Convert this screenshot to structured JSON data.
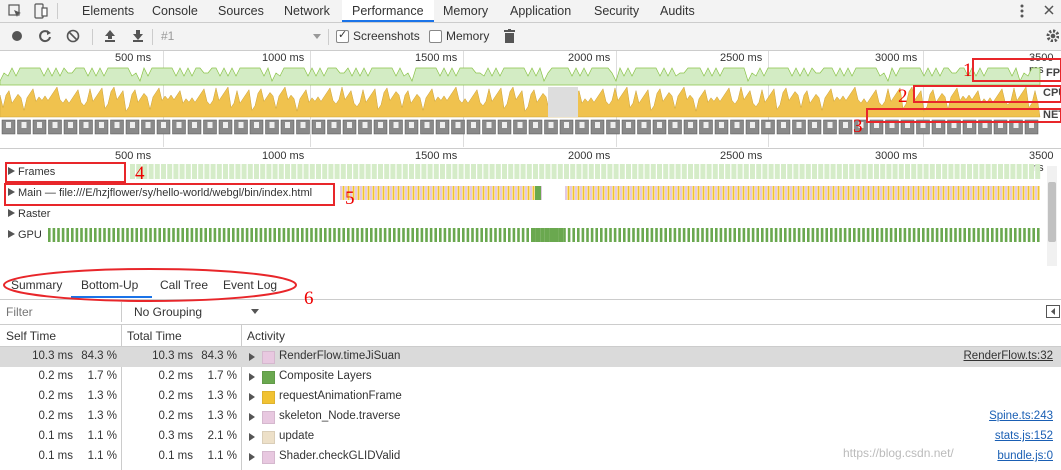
{
  "tabs": [
    "Elements",
    "Console",
    "Sources",
    "Network",
    "Performance",
    "Memory",
    "Application",
    "Security",
    "Audits"
  ],
  "active_tab": "Performance",
  "toolbar": {
    "profile_select": "#1",
    "screenshots_label": "Screenshots",
    "memory_label": "Memory"
  },
  "overview": {
    "ticks": [
      "500 ms",
      "1000 ms",
      "1500 ms",
      "2000 ms",
      "2500 ms",
      "3000 ms",
      "3500 ms"
    ],
    "track_labels": [
      "FPS",
      "CPU",
      "NET"
    ]
  },
  "timeline": {
    "ticks": [
      "500 ms",
      "1000 ms",
      "1500 ms",
      "2000 ms",
      "2500 ms",
      "3000 ms",
      "3500 ms"
    ],
    "frames_label": "Frames",
    "main_label": "Main — file:///E/hzjflower/sy/hello-world/webgl/bin/index.html",
    "raster_label": "Raster",
    "gpu_label": "GPU"
  },
  "bottom_tabs": [
    "Summary",
    "Bottom-Up",
    "Call Tree",
    "Event Log"
  ],
  "active_bottom_tab": "Bottom-Up",
  "filter": {
    "placeholder": "Filter",
    "grouping": "No Grouping"
  },
  "table": {
    "headers": {
      "self": "Self Time",
      "total": "Total Time",
      "activity": "Activity"
    },
    "rows": [
      {
        "self_ms": "10.3 ms",
        "self_pct": "84.3 %",
        "total_ms": "10.3 ms",
        "total_pct": "84.3 %",
        "activity": "RenderFlow.timeJiSuan",
        "color": "#e8c8e0",
        "source": "RenderFlow.ts:32"
      },
      {
        "self_ms": "0.2 ms",
        "self_pct": "1.7 %",
        "total_ms": "0.2 ms",
        "total_pct": "1.7 %",
        "activity": "Composite Layers",
        "color": "#6aa84f",
        "source": ""
      },
      {
        "self_ms": "0.2 ms",
        "self_pct": "1.3 %",
        "total_ms": "0.2 ms",
        "total_pct": "1.3 %",
        "activity": "requestAnimationFrame",
        "color": "#f1c232",
        "source": ""
      },
      {
        "self_ms": "0.2 ms",
        "self_pct": "1.3 %",
        "total_ms": "0.2 ms",
        "total_pct": "1.3 %",
        "activity": "skeleton_Node.traverse",
        "color": "#e8c8e0",
        "source": "Spine.ts:243"
      },
      {
        "self_ms": "0.1 ms",
        "self_pct": "1.1 %",
        "total_ms": "0.3 ms",
        "total_pct": "2.1 %",
        "activity": "update",
        "color": "#ede0c8",
        "source": "stats.js:152"
      },
      {
        "self_ms": "0.1 ms",
        "self_pct": "1.1 %",
        "total_ms": "0.1 ms",
        "total_pct": "1.1 %",
        "activity": "Shader.checkGLIDValid",
        "color": "#e8c8e0",
        "source": "bundle.js:0"
      }
    ]
  },
  "annotations": [
    "1",
    "2",
    "3",
    "4",
    "5",
    "6"
  ],
  "watermark": "https://blog.csdn.net/"
}
